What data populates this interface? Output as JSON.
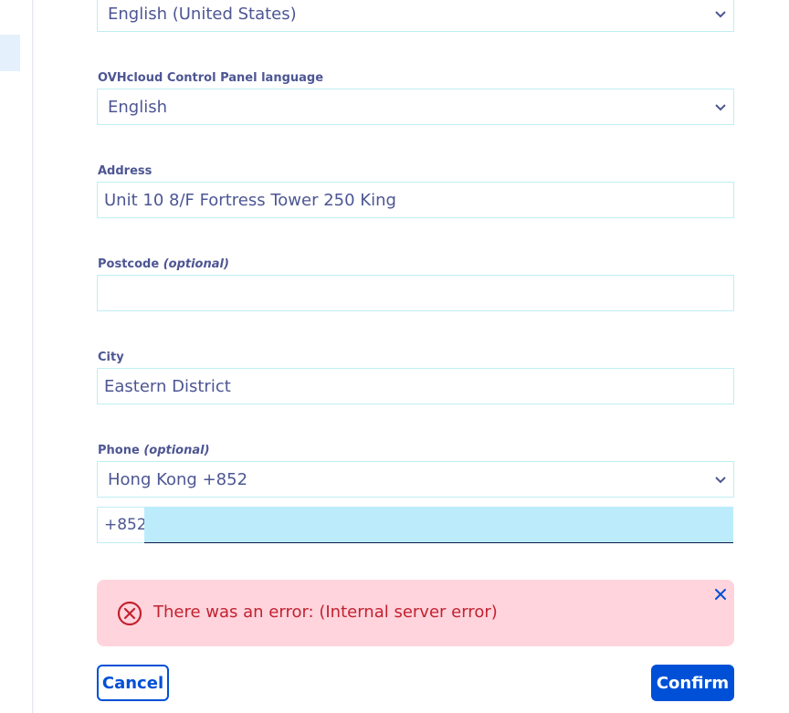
{
  "form": {
    "language_select": {
      "value": "English (United States)"
    },
    "panel_language": {
      "label": "OVHcloud Control Panel language",
      "value": "English"
    },
    "address": {
      "label": "Address",
      "value": "Unit 10 8/F Fortress Tower 250 King"
    },
    "postcode": {
      "label": "Postcode",
      "optional": "(optional)",
      "value": ""
    },
    "city": {
      "label": "City",
      "value": "Eastern District"
    },
    "phone": {
      "label": "Phone",
      "optional": "(optional)",
      "country_value": "Hong Kong +852",
      "prefix": "+852",
      "value": ""
    }
  },
  "error": {
    "message": "There was an error: (Internal server error)"
  },
  "actions": {
    "cancel_label": "Cancel",
    "confirm_label": "Confirm"
  },
  "colors": {
    "label": "#4d5693",
    "field_border": "#bfeff3",
    "focused_input_bg": "#bcecfb",
    "error_bg": "#ffd4dd",
    "error_text": "#c2222f",
    "primary": "#0050d7"
  },
  "icons": {
    "select_chevron": "chevron-down-icon",
    "error": "error-circle-x-icon",
    "close": "close-icon"
  }
}
